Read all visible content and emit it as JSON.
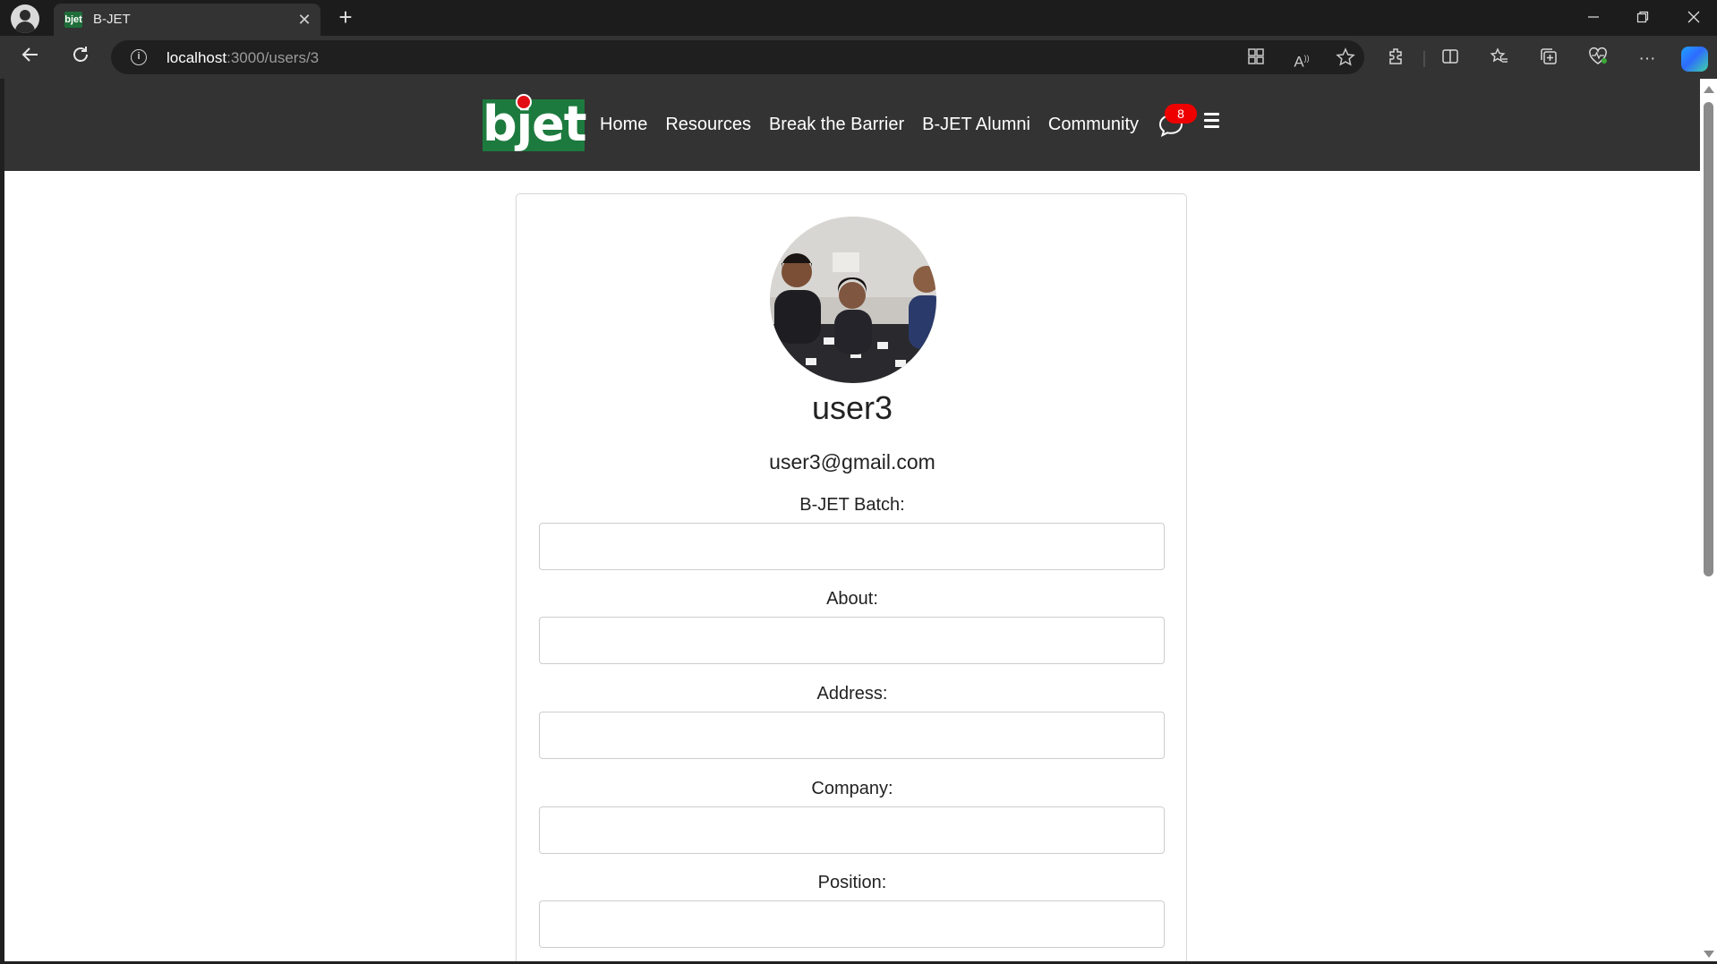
{
  "browser": {
    "tab_title": "B-JET",
    "tab_favicon_text": "bjet",
    "url_host": "localhost",
    "url_path": ":3000/users/3",
    "new_tab_symbol": "+",
    "close_symbol": "✕",
    "icons": [
      "back-icon",
      "refresh-icon",
      "info-icon",
      "app-available-icon",
      "read-aloud-icon",
      "favorite-star-icon",
      "extensions-icon",
      "split-screen-icon",
      "favorites-icon",
      "collections-icon",
      "browser-essentials-icon",
      "more-options-icon",
      "copilot-icon"
    ]
  },
  "site_nav": {
    "logo_text": "bjet",
    "links": [
      "Home",
      "Resources",
      "Break the Barrier",
      "B-JET Alumni",
      "Community"
    ],
    "notification_count": "8"
  },
  "profile": {
    "username": "user3",
    "email": "user3@gmail.com",
    "fields": [
      {
        "label": "B-JET Batch:",
        "value": ""
      },
      {
        "label": "About:",
        "value": ""
      },
      {
        "label": "Address:",
        "value": ""
      },
      {
        "label": "Company:",
        "value": ""
      },
      {
        "label": "Position:",
        "value": ""
      }
    ]
  },
  "colors": {
    "nav_bg": "#333333",
    "logo_green": "#1d7a3e",
    "badge_red": "#ee0000"
  }
}
